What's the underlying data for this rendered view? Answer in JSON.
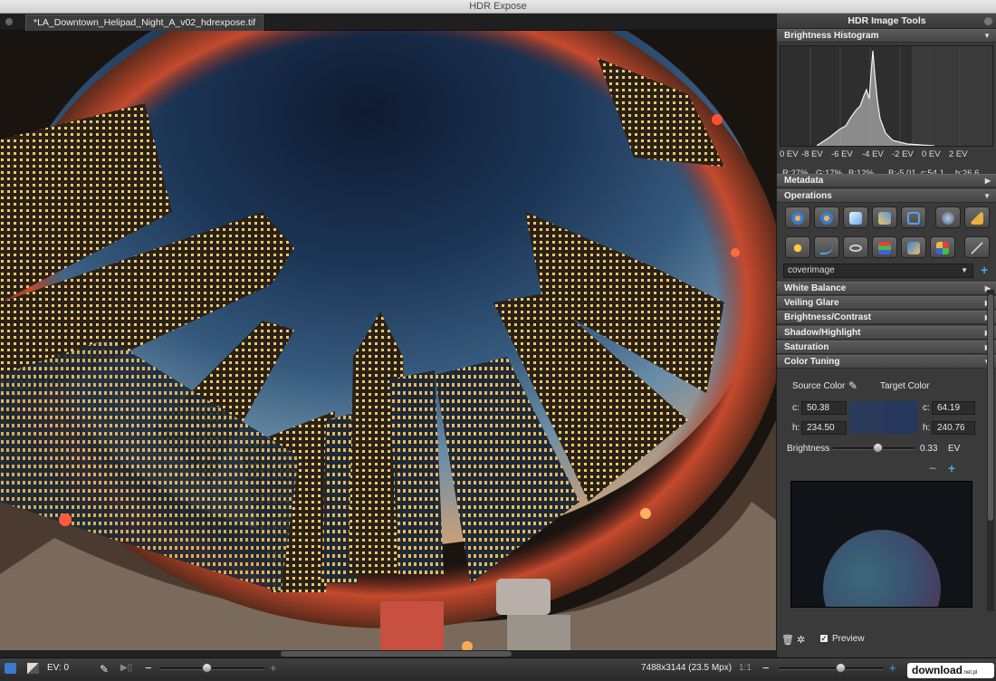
{
  "app": {
    "title": "HDR Expose"
  },
  "document": {
    "tab_label": "*LA_Downtown_Helipad_Night_A_v02_hdrexpose.tif"
  },
  "panel": {
    "title": "HDR Image Tools",
    "histogram": {
      "header": "Brightness Histogram",
      "axis_labels": [
        "0 EV",
        "-8 EV",
        "-6 EV",
        "-4 EV",
        "-2 EV",
        "0 EV",
        "2 EV"
      ],
      "readout": {
        "r": "R:27%",
        "g": "G:17%",
        "b": "B:12%",
        "b_ev": "B:-5.01",
        "c": "c:54.1",
        "h": "h:26.6"
      }
    },
    "sections": {
      "metadata": "Metadata",
      "operations": "Operations",
      "white_balance": "White Balance",
      "veiling_glare": "Veiling Glare",
      "brightness_contrast": "Brightness/Contrast",
      "shadow_highlight": "Shadow/Highlight",
      "saturation": "Saturation",
      "color_tuning": "Color Tuning"
    },
    "operations": {
      "row1_icons": [
        "rotate-ccw-icon",
        "rotate-cw-icon",
        "flip-icon",
        "crop-icon",
        "resize-icon",
        "lens-icon",
        "brush-icon"
      ],
      "row2_icons": [
        "exposure-icon",
        "curve-icon",
        "glasses-icon",
        "levels-icon",
        "monitor-icon",
        "palette-icon",
        "magic-wand-icon"
      ],
      "preset_value": "coverimage"
    },
    "color_tuning": {
      "source_label": "Source Color",
      "target_label": "Target Color",
      "source_c_label": "c:",
      "source_c": "50.38",
      "source_h_label": "h:",
      "source_h": "234.50",
      "target_c_label": "c:",
      "target_c": "64.19",
      "target_h_label": "h:",
      "target_h": "240.76",
      "brightness_label": "Brightness",
      "brightness_value": "0.33",
      "brightness_unit": "EV",
      "brightness_level": 0.55,
      "source_color": "#2a3a5a",
      "target_color": "#26375e"
    },
    "footer": {
      "preview_label": "Preview",
      "preview_checked": true
    }
  },
  "status": {
    "ev_label": "EV: 0",
    "dimensions": "7488x3144 (23.5 Mpx)",
    "zoom": "1:1",
    "ev_slider_level": 0.45,
    "zoom_slider_level": 0.6
  },
  "watermark": {
    "text": "download",
    "suffix": ".net.pl"
  },
  "colors": {
    "accent": "#4aa8e8",
    "panel_bg": "#3a3a3a",
    "section_bg": "#4f4f4f"
  }
}
